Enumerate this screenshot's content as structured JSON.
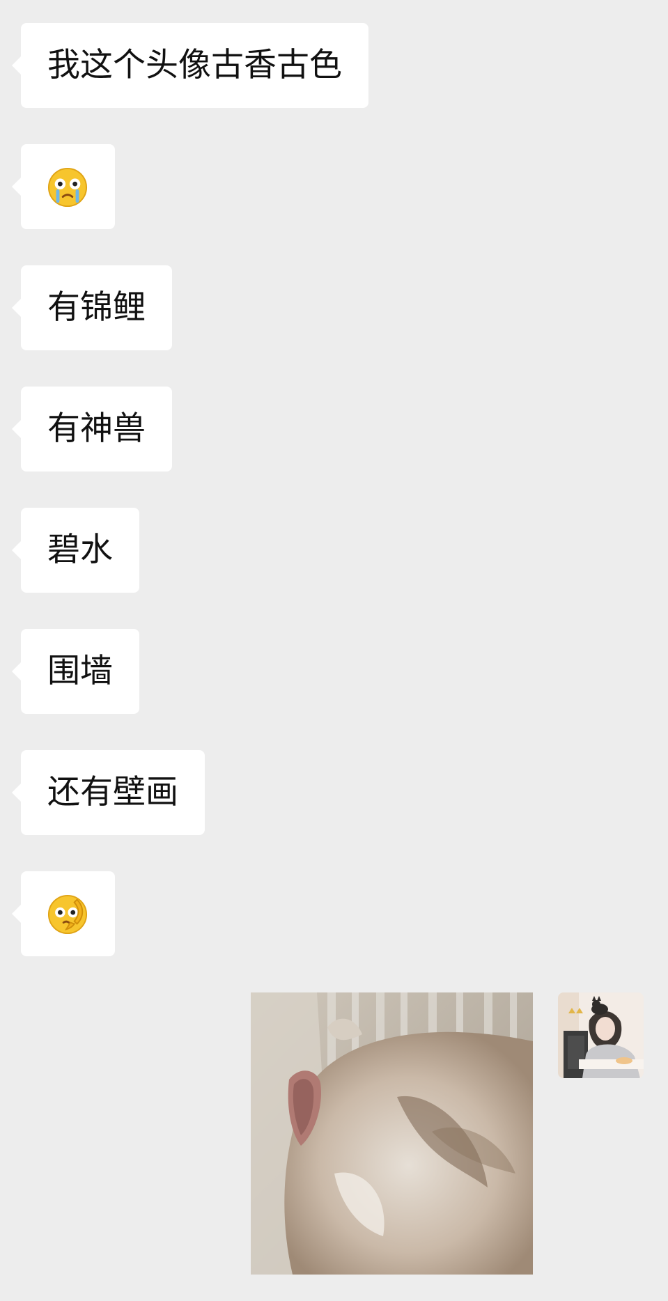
{
  "messages": [
    {
      "text": "我这个头像古香古色"
    },
    {
      "emoji": "crying-face-emoji"
    },
    {
      "text": "有锦鲤"
    },
    {
      "text": "有神兽"
    },
    {
      "text": "碧水"
    },
    {
      "text": "围墙"
    },
    {
      "text": "还有壁画"
    },
    {
      "emoji": "thinking-face-emoji"
    }
  ],
  "sent": {
    "image": "sleeping-cat-photo",
    "avatar": "girl-with-cat-avatar"
  },
  "colors": {
    "background": "#ededed",
    "bubble": "#ffffff",
    "text": "#111111"
  }
}
